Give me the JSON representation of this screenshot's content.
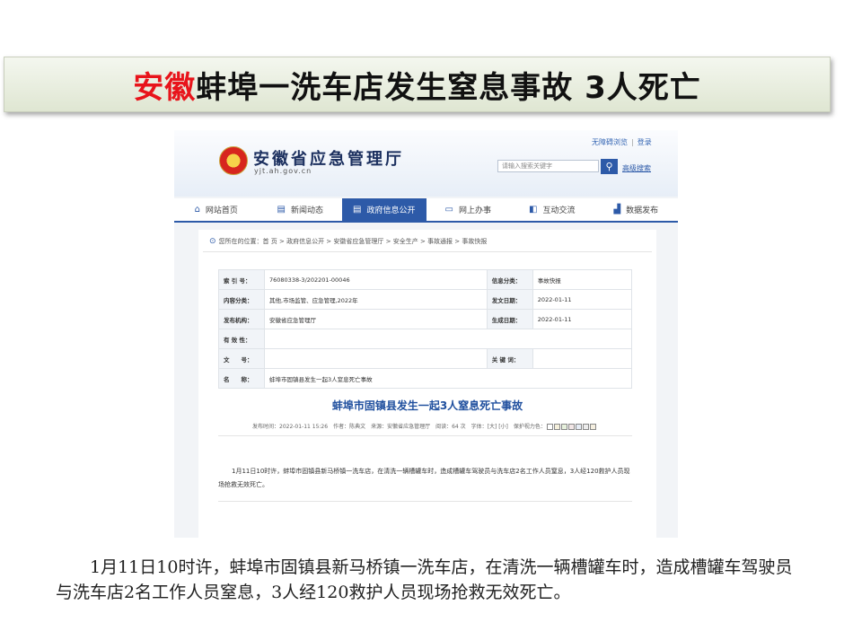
{
  "slide": {
    "title_highlight": "安徽",
    "title_rest": "蚌埠一洗车店发生窒息事故 3人死亡",
    "paragraph": "1月11日10时许，蚌埠市固镇县新马桥镇一洗车店，在清洗一辆槽罐车时，造成槽罐车驾驶员与洗车店2名工作人员窒息，3人经120救护人员现场抢救无效死亡。"
  },
  "site": {
    "name": "安徽省应急管理厅",
    "url": "yjt.ah.gov.cn",
    "top_links": [
      "无障碍浏览",
      "登录"
    ],
    "search_placeholder": "请输入搜索关键字",
    "advanced_search": "高级搜索"
  },
  "nav": [
    {
      "label": "网站首页",
      "icon": "home-icon",
      "glyph": "⌂"
    },
    {
      "label": "新闻动态",
      "icon": "news-icon",
      "glyph": "▤"
    },
    {
      "label": "政府信息公开",
      "icon": "document-icon",
      "glyph": "▤",
      "active": true
    },
    {
      "label": "网上办事",
      "icon": "monitor-icon",
      "glyph": "▭"
    },
    {
      "label": "互动交流",
      "icon": "chat-icon",
      "glyph": "◧"
    },
    {
      "label": "数据发布",
      "icon": "chart-icon",
      "glyph": "▟"
    }
  ],
  "breadcrumb": "您所在的位置：首 页 > 政府信息公开 > 安徽省应急管理厅 > 安全生产 > 事故通报 > 事故快报",
  "meta": {
    "index_label": "索 引 号：",
    "index_value": "76080338-3/202201-00046",
    "category_label": "信息分类：",
    "category_value": "事故快报",
    "content_label": "内容分类：",
    "content_value": "其他,市场监管、应急管理,2022年",
    "issued_label": "发文日期：",
    "issued_value": "2022-01-11",
    "publisher_label": "发布机构：",
    "publisher_value": "安徽省应急管理厅",
    "effective_label": "生成日期：",
    "effective_value": "2022-01-11",
    "validity_label": "有 效 性：",
    "validity_value": "",
    "doc_label": "文　　号：",
    "doc_value": "",
    "keyword_label": "关 键 词：",
    "keyword_value": "",
    "name_label": "名　　称：",
    "name_value": "蚌埠市固镇县发生一起3人窒息死亡事故"
  },
  "article": {
    "title": "蚌埠市固镇县发生一起3人窒息死亡事故",
    "info": "发布时间：2022-01-11 15:26　作者：陈典文　来源：安徽省应急管理厅　阅读：64 次　字体：[大] [小]　保护视力色：",
    "body": "1月11日10时许，蚌埠市固镇县新马桥镇一洗车店，在清洗一辆槽罐车时，造成槽罐车驾驶员与洗车店2名工作人员窒息，3人经120救护人员现场抢救无效死亡。"
  },
  "colors": {
    "title_red": "#e8141b",
    "link_blue": "#2d5aa8",
    "article_title": "#1f4f9e"
  }
}
